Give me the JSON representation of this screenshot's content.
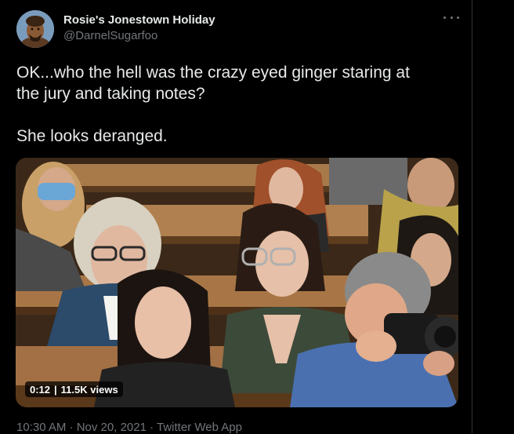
{
  "tweet": {
    "display_name": "Rosie's Jonestown Holiday",
    "handle": "@DarnelSugarfoo",
    "text": "OK...who the hell was the crazy eyed ginger staring at\nthe jury and taking notes?\n\nShe looks deranged.",
    "timestamp": "10:30 AM · Nov 20, 2021 · Twitter Web App"
  },
  "video": {
    "duration": "0:12",
    "views": "11.5K views"
  },
  "icons": {
    "more": "more-horizontal-icon",
    "avatar": "avatar-image"
  }
}
